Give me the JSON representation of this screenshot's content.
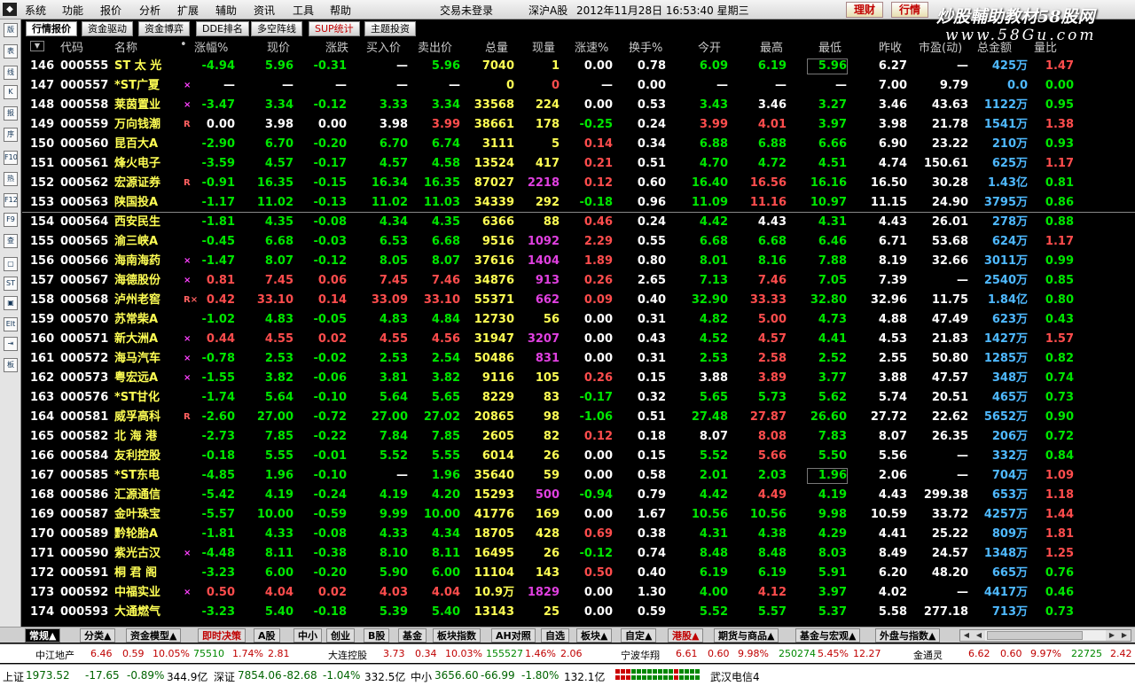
{
  "menubar": {
    "items": [
      "系统",
      "功能",
      "报价",
      "分析",
      "扩展",
      "辅助",
      "资讯",
      "工具",
      "帮助"
    ],
    "login_status": "交易未登录",
    "market": "深沪A股",
    "datetime": "2012年11月28日  16:53:40  星期三",
    "buttons": [
      "理财",
      "行情"
    ]
  },
  "watermark": {
    "line1": "炒股輔助教材58股网",
    "line2": "www.58Gu.com"
  },
  "left_toolbar": [
    "版",
    "表",
    "线",
    "K",
    "报",
    "序",
    "F10",
    "热",
    "F12",
    "F9",
    "查",
    "▢",
    "ST",
    "▣",
    "EIt",
    "⇥",
    "板"
  ],
  "top_tabs": [
    "行情报价",
    "资金驱动",
    "资金博弈",
    "DDE排名",
    "多空阵线",
    "SUP统计",
    "主题投资"
  ],
  "columns": [
    "",
    "代码",
    "名称",
    "•",
    "涨幅%",
    "现价",
    "涨跌",
    "买入价",
    "卖出价",
    "总量",
    "现量",
    "涨速%",
    "换手%",
    "今开",
    "最高",
    "最低",
    "昨收",
    "市盈(动)",
    "总金额",
    "量比"
  ],
  "colors": {
    "up": "#ff4d4d",
    "down": "#00e600",
    "neutral": "#ffffff",
    "name": "#ffff54",
    "code": "#ffffff",
    "amount": "#4fb9ff",
    "volume": "#ffff54",
    "purple": "#e040e0",
    "header": "#c8c8c8",
    "row_num": "#ffffff"
  },
  "rows": [
    {
      "n": "146",
      "code": "000555",
      "name": "ST 太 光",
      "flag": "",
      "pct": "-4.94",
      "price": "5.96",
      "chg": "-0.31",
      "bid": "—",
      "ask": "5.96",
      "vol": "7040",
      "cur": "1",
      "spd": "0.00",
      "turn": "0.78",
      "open": "6.09",
      "high": "6.19",
      "low": "5.96",
      "prev": "6.27",
      "pe": "—",
      "amt": "425万",
      "ratio": "1.47"
    },
    {
      "n": "147",
      "code": "000557",
      "name": "*ST广夏",
      "flag": "×",
      "pct": "—",
      "price": "—",
      "chg": "—",
      "bid": "—",
      "ask": "—",
      "vol": "0",
      "cur": "0",
      "spd": "—",
      "turn": "0.00",
      "open": "—",
      "high": "—",
      "low": "—",
      "prev": "7.00",
      "pe": "9.79",
      "amt": "0.0",
      "ratio": "0.00"
    },
    {
      "n": "148",
      "code": "000558",
      "name": "莱茵置业",
      "flag": "×",
      "pct": "-3.47",
      "price": "3.34",
      "chg": "-0.12",
      "bid": "3.33",
      "ask": "3.34",
      "vol": "33568",
      "cur": "224",
      "spd": "0.00",
      "turn": "0.53",
      "open": "3.43",
      "high": "3.46",
      "low": "3.27",
      "prev": "3.46",
      "pe": "43.63",
      "amt": "1122万",
      "ratio": "0.95"
    },
    {
      "n": "149",
      "code": "000559",
      "name": "万向钱潮",
      "flag": "R",
      "pct": "0.00",
      "price": "3.98",
      "chg": "0.00",
      "bid": "3.98",
      "ask": "3.99",
      "vol": "38661",
      "cur": "178",
      "spd": "-0.25",
      "turn": "0.24",
      "open": "3.99",
      "high": "4.01",
      "low": "3.97",
      "prev": "3.98",
      "pe": "21.78",
      "amt": "1541万",
      "ratio": "1.38"
    },
    {
      "n": "150",
      "code": "000560",
      "name": "昆百大A",
      "flag": "",
      "pct": "-2.90",
      "price": "6.70",
      "chg": "-0.20",
      "bid": "6.70",
      "ask": "6.74",
      "vol": "3111",
      "cur": "5",
      "spd": "0.14",
      "turn": "0.34",
      "open": "6.88",
      "high": "6.88",
      "low": "6.66",
      "prev": "6.90",
      "pe": "23.22",
      "amt": "210万",
      "ratio": "0.93"
    },
    {
      "n": "151",
      "code": "000561",
      "name": "烽火电子",
      "flag": "",
      "pct": "-3.59",
      "price": "4.57",
      "chg": "-0.17",
      "bid": "4.57",
      "ask": "4.58",
      "vol": "13524",
      "cur": "417",
      "spd": "0.21",
      "turn": "0.51",
      "open": "4.70",
      "high": "4.72",
      "low": "4.51",
      "prev": "4.74",
      "pe": "150.61",
      "amt": "625万",
      "ratio": "1.17"
    },
    {
      "n": "152",
      "code": "000562",
      "name": "宏源证券",
      "flag": "R",
      "pct": "-0.91",
      "price": "16.35",
      "chg": "-0.15",
      "bid": "16.34",
      "ask": "16.35",
      "vol": "87027",
      "cur": "2218",
      "spd": "0.12",
      "turn": "0.60",
      "open": "16.40",
      "high": "16.56",
      "low": "16.16",
      "prev": "16.50",
      "pe": "30.28",
      "amt": "1.43亿",
      "ratio": "0.81"
    },
    {
      "n": "153",
      "code": "000563",
      "name": "陕国投A",
      "flag": "",
      "pct": "-1.17",
      "price": "11.02",
      "chg": "-0.13",
      "bid": "11.02",
      "ask": "11.03",
      "vol": "34339",
      "cur": "292",
      "spd": "-0.18",
      "turn": "0.96",
      "open": "11.09",
      "high": "11.16",
      "low": "10.97",
      "prev": "11.15",
      "pe": "24.90",
      "amt": "3795万",
      "ratio": "0.86"
    },
    {
      "n": "154",
      "code": "000564",
      "name": "西安民生",
      "flag": "",
      "pct": "-1.81",
      "price": "4.35",
      "chg": "-0.08",
      "bid": "4.34",
      "ask": "4.35",
      "vol": "6366",
      "cur": "88",
      "spd": "0.46",
      "turn": "0.24",
      "open": "4.42",
      "high": "4.43",
      "low": "4.31",
      "prev": "4.43",
      "pe": "26.01",
      "amt": "278万",
      "ratio": "0.88"
    },
    {
      "n": "155",
      "code": "000565",
      "name": "渝三峡A",
      "flag": "",
      "pct": "-0.45",
      "price": "6.68",
      "chg": "-0.03",
      "bid": "6.53",
      "ask": "6.68",
      "vol": "9516",
      "cur": "1092",
      "spd": "2.29",
      "turn": "0.55",
      "open": "6.68",
      "high": "6.68",
      "low": "6.46",
      "prev": "6.71",
      "pe": "53.68",
      "amt": "624万",
      "ratio": "1.17"
    },
    {
      "n": "156",
      "code": "000566",
      "name": "海南海药",
      "flag": "×",
      "pct": "-1.47",
      "price": "8.07",
      "chg": "-0.12",
      "bid": "8.05",
      "ask": "8.07",
      "vol": "37616",
      "cur": "1404",
      "spd": "1.89",
      "turn": "0.80",
      "open": "8.01",
      "high": "8.16",
      "low": "7.88",
      "prev": "8.19",
      "pe": "32.66",
      "amt": "3011万",
      "ratio": "0.99"
    },
    {
      "n": "157",
      "code": "000567",
      "name": "海德股份",
      "flag": "×",
      "pct": "0.81",
      "price": "7.45",
      "chg": "0.06",
      "bid": "7.45",
      "ask": "7.46",
      "vol": "34876",
      "cur": "913",
      "spd": "0.26",
      "turn": "2.65",
      "open": "7.13",
      "high": "7.46",
      "low": "7.05",
      "prev": "7.39",
      "pe": "—",
      "amt": "2540万",
      "ratio": "0.85"
    },
    {
      "n": "158",
      "code": "000568",
      "name": "泸州老窖",
      "flag": "R×",
      "pct": "0.42",
      "price": "33.10",
      "chg": "0.14",
      "bid": "33.09",
      "ask": "33.10",
      "vol": "55371",
      "cur": "662",
      "spd": "0.09",
      "turn": "0.40",
      "open": "32.90",
      "high": "33.33",
      "low": "32.80",
      "prev": "32.96",
      "pe": "11.75",
      "amt": "1.84亿",
      "ratio": "0.80"
    },
    {
      "n": "159",
      "code": "000570",
      "name": "苏常柴A",
      "flag": "",
      "pct": "-1.02",
      "price": "4.83",
      "chg": "-0.05",
      "bid": "4.83",
      "ask": "4.84",
      "vol": "12730",
      "cur": "56",
      "spd": "0.00",
      "turn": "0.31",
      "open": "4.82",
      "high": "5.00",
      "low": "4.73",
      "prev": "4.88",
      "pe": "47.49",
      "amt": "623万",
      "ratio": "0.43"
    },
    {
      "n": "160",
      "code": "000571",
      "name": "新大洲A",
      "flag": "×",
      "pct": "0.44",
      "price": "4.55",
      "chg": "0.02",
      "bid": "4.55",
      "ask": "4.56",
      "vol": "31947",
      "cur": "3207",
      "spd": "0.00",
      "turn": "0.43",
      "open": "4.52",
      "high": "4.57",
      "low": "4.41",
      "prev": "4.53",
      "pe": "21.83",
      "amt": "1427万",
      "ratio": "1.57"
    },
    {
      "n": "161",
      "code": "000572",
      "name": "海马汽车",
      "flag": "×",
      "pct": "-0.78",
      "price": "2.53",
      "chg": "-0.02",
      "bid": "2.53",
      "ask": "2.54",
      "vol": "50486",
      "cur": "831",
      "spd": "0.00",
      "turn": "0.31",
      "open": "2.53",
      "high": "2.58",
      "low": "2.52",
      "prev": "2.55",
      "pe": "50.80",
      "amt": "1285万",
      "ratio": "0.82"
    },
    {
      "n": "162",
      "code": "000573",
      "name": "粤宏远A",
      "flag": "×",
      "pct": "-1.55",
      "price": "3.82",
      "chg": "-0.06",
      "bid": "3.81",
      "ask": "3.82",
      "vol": "9116",
      "cur": "105",
      "spd": "0.26",
      "turn": "0.15",
      "open": "3.88",
      "high": "3.89",
      "low": "3.77",
      "prev": "3.88",
      "pe": "47.57",
      "amt": "348万",
      "ratio": "0.74"
    },
    {
      "n": "163",
      "code": "000576",
      "name": "*ST甘化",
      "flag": "",
      "pct": "-1.74",
      "price": "5.64",
      "chg": "-0.10",
      "bid": "5.64",
      "ask": "5.65",
      "vol": "8229",
      "cur": "83",
      "spd": "-0.17",
      "turn": "0.32",
      "open": "5.65",
      "high": "5.73",
      "low": "5.62",
      "prev": "5.74",
      "pe": "20.51",
      "amt": "465万",
      "ratio": "0.73"
    },
    {
      "n": "164",
      "code": "000581",
      "name": "威孚高科",
      "flag": "R",
      "pct": "-2.60",
      "price": "27.00",
      "chg": "-0.72",
      "bid": "27.00",
      "ask": "27.02",
      "vol": "20865",
      "cur": "98",
      "spd": "-1.06",
      "turn": "0.51",
      "open": "27.48",
      "high": "27.87",
      "low": "26.60",
      "prev": "27.72",
      "pe": "22.62",
      "amt": "5652万",
      "ratio": "0.90"
    },
    {
      "n": "165",
      "code": "000582",
      "name": "北 海 港",
      "flag": "",
      "pct": "-2.73",
      "price": "7.85",
      "chg": "-0.22",
      "bid": "7.84",
      "ask": "7.85",
      "vol": "2605",
      "cur": "82",
      "spd": "0.12",
      "turn": "0.18",
      "open": "8.07",
      "high": "8.08",
      "low": "7.83",
      "prev": "8.07",
      "pe": "26.35",
      "amt": "206万",
      "ratio": "0.72"
    },
    {
      "n": "166",
      "code": "000584",
      "name": "友利控股",
      "flag": "",
      "pct": "-0.18",
      "price": "5.55",
      "chg": "-0.01",
      "bid": "5.52",
      "ask": "5.55",
      "vol": "6014",
      "cur": "26",
      "spd": "0.00",
      "turn": "0.15",
      "open": "5.52",
      "high": "5.66",
      "low": "5.50",
      "prev": "5.56",
      "pe": "—",
      "amt": "332万",
      "ratio": "0.84"
    },
    {
      "n": "167",
      "code": "000585",
      "name": "*ST东电",
      "flag": "",
      "pct": "-4.85",
      "price": "1.96",
      "chg": "-0.10",
      "bid": "—",
      "ask": "1.96",
      "vol": "35640",
      "cur": "59",
      "spd": "0.00",
      "turn": "0.58",
      "open": "2.01",
      "high": "2.03",
      "low": "1.96",
      "prev": "2.06",
      "pe": "—",
      "amt": "704万",
      "ratio": "1.09"
    },
    {
      "n": "168",
      "code": "000586",
      "name": "汇源通信",
      "flag": "",
      "pct": "-5.42",
      "price": "4.19",
      "chg": "-0.24",
      "bid": "4.19",
      "ask": "4.20",
      "vol": "15293",
      "cur": "500",
      "spd": "-0.94",
      "turn": "0.79",
      "open": "4.42",
      "high": "4.49",
      "low": "4.19",
      "prev": "4.43",
      "pe": "299.38",
      "amt": "653万",
      "ratio": "1.18"
    },
    {
      "n": "169",
      "code": "000587",
      "name": "金叶珠宝",
      "flag": "",
      "pct": "-5.57",
      "price": "10.00",
      "chg": "-0.59",
      "bid": "9.99",
      "ask": "10.00",
      "vol": "41776",
      "cur": "169",
      "spd": "0.00",
      "turn": "1.67",
      "open": "10.56",
      "high": "10.56",
      "low": "9.98",
      "prev": "10.59",
      "pe": "33.72",
      "amt": "4257万",
      "ratio": "1.44"
    },
    {
      "n": "170",
      "code": "000589",
      "name": "黔轮胎A",
      "flag": "",
      "pct": "-1.81",
      "price": "4.33",
      "chg": "-0.08",
      "bid": "4.33",
      "ask": "4.34",
      "vol": "18705",
      "cur": "428",
      "spd": "0.69",
      "turn": "0.38",
      "open": "4.31",
      "high": "4.38",
      "low": "4.29",
      "prev": "4.41",
      "pe": "25.22",
      "amt": "809万",
      "ratio": "1.81"
    },
    {
      "n": "171",
      "code": "000590",
      "name": "紫光古汉",
      "flag": "×",
      "pct": "-4.48",
      "price": "8.11",
      "chg": "-0.38",
      "bid": "8.10",
      "ask": "8.11",
      "vol": "16495",
      "cur": "26",
      "spd": "-0.12",
      "turn": "0.74",
      "open": "8.48",
      "high": "8.48",
      "low": "8.03",
      "prev": "8.49",
      "pe": "24.57",
      "amt": "1348万",
      "ratio": "1.25"
    },
    {
      "n": "172",
      "code": "000591",
      "name": "桐 君 阁",
      "flag": "",
      "pct": "-3.23",
      "price": "6.00",
      "chg": "-0.20",
      "bid": "5.90",
      "ask": "6.00",
      "vol": "11104",
      "cur": "143",
      "spd": "0.50",
      "turn": "0.40",
      "open": "6.19",
      "high": "6.19",
      "low": "5.91",
      "prev": "6.20",
      "pe": "48.20",
      "amt": "665万",
      "ratio": "0.76"
    },
    {
      "n": "173",
      "code": "000592",
      "name": "中福实业",
      "flag": "×",
      "pct": "0.50",
      "price": "4.04",
      "chg": "0.02",
      "bid": "4.03",
      "ask": "4.04",
      "vol": "10.9万",
      "cur": "1829",
      "spd": "0.00",
      "turn": "1.30",
      "open": "4.00",
      "high": "4.12",
      "low": "3.97",
      "prev": "4.02",
      "pe": "—",
      "amt": "4417万",
      "ratio": "0.46"
    },
    {
      "n": "174",
      "code": "000593",
      "name": "大通燃气",
      "flag": "",
      "pct": "-3.23",
      "price": "5.40",
      "chg": "-0.18",
      "bid": "5.39",
      "ask": "5.40",
      "vol": "13143",
      "cur": "25",
      "spd": "0.00",
      "turn": "0.59",
      "open": "5.52",
      "high": "5.57",
      "low": "5.37",
      "prev": "5.58",
      "pe": "277.18",
      "amt": "713万",
      "ratio": "0.73"
    }
  ],
  "bottom_tabs": [
    "常规▲",
    "分类▲",
    "资金模型▲",
    "即时决策",
    "A股",
    "中小",
    "创业",
    "B股",
    "基金",
    "板块指数",
    "AH对照",
    "自选",
    "板块▲",
    "自定▲",
    "港股▲",
    "期货与商品▲",
    "基金与宏观▲",
    "外盘与指数▲"
  ],
  "ticker": [
    {
      "name": "中江地产",
      "vals": [
        "6.46",
        "0.59",
        "10.05%",
        "75510",
        "1.74%",
        "2.81"
      ]
    },
    {
      "name": "大连控股",
      "vals": [
        "3.73",
        "0.34",
        "10.03%",
        "155527",
        "1.46%",
        "2.06"
      ]
    },
    {
      "name": "宁波华翔",
      "vals": [
        "6.61",
        "0.60",
        "9.98%",
        "250274",
        "5.45%",
        "12.27"
      ]
    },
    {
      "name": "金通灵",
      "vals": [
        "6.62",
        "0.60",
        "9.97%",
        "22725",
        "2.42"
      ]
    }
  ],
  "status": {
    "sh_label": "上证",
    "sh_val": "1973.52",
    "sh_chg": "-17.65",
    "sh_pct": "-0.89%",
    "sh_amt": "344.9亿",
    "sz_label": "深证",
    "sz_val": "7854.06",
    "sz_chg": "-82.68",
    "sz_pct": "-1.04%",
    "sz_amt": "332.5亿",
    "zx_label": "中小",
    "zx_val": "3656.60",
    "zx_chg": "-66.99",
    "zx_pct": "-1.80%",
    "zx_amt": "132.1亿",
    "news": "武汉电信4"
  }
}
